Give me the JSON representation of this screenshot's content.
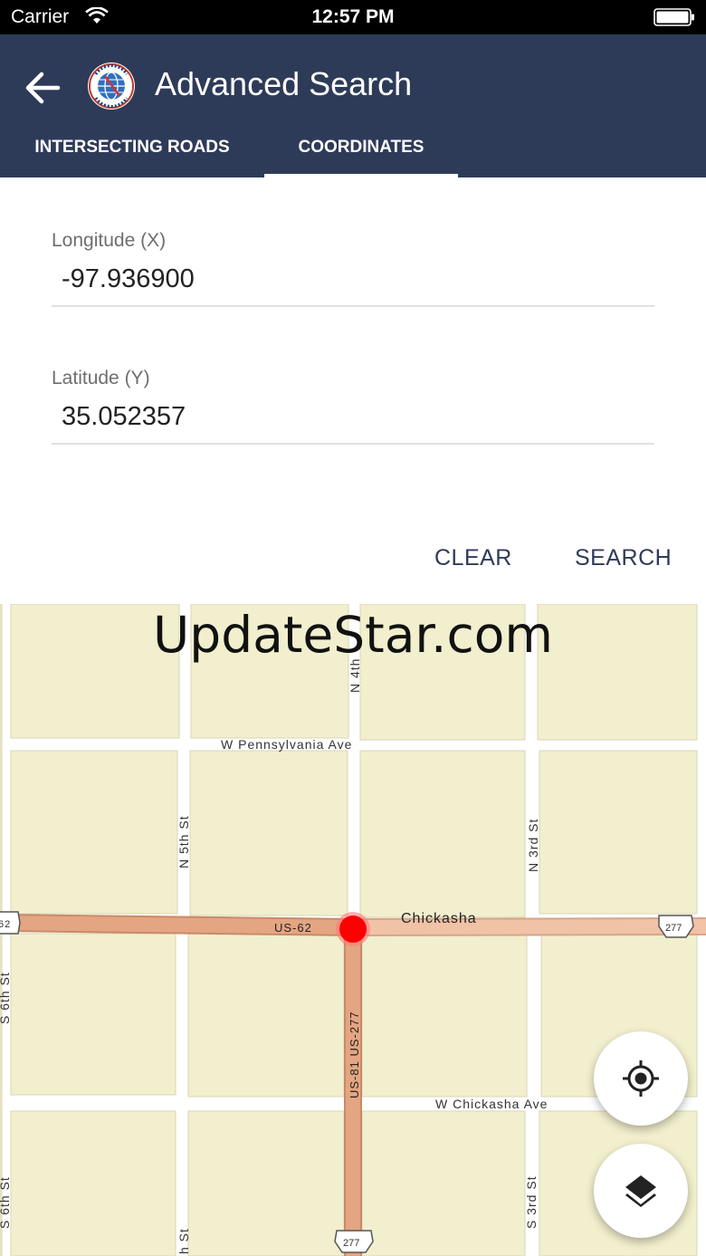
{
  "status_bar": {
    "carrier": "Carrier",
    "time": "12:57 PM"
  },
  "app_bar": {
    "title": "Advanced Search",
    "logo_text": "SPATIAL DATA RESEARCH",
    "tabs": [
      {
        "label": "INTERSECTING ROADS",
        "selected": false
      },
      {
        "label": "COORDINATES",
        "selected": true
      }
    ]
  },
  "form": {
    "longitude": {
      "label": "Longitude (X)",
      "value": "-97.936900"
    },
    "latitude": {
      "label": "Latitude (Y)",
      "value": "35.052357"
    },
    "clear_label": "CLEAR",
    "search_label": "SEARCH"
  },
  "map": {
    "watermark": "UpdateStar.com",
    "street_labels": {
      "n_4th": "N 4th",
      "pennsylvania": "W Pennsylvania Ave",
      "n_5th": "N 5th St",
      "n_3rd": "N 3rd St",
      "us62_left": "62",
      "us62": "US-62",
      "chickasha": "Chickasha",
      "us277_shield_right": "277",
      "s_6th_top": "S 6th St",
      "us81_277": "US-81 US-277",
      "w_chickasha": "W Chickasha Ave",
      "s_6th": "S 6th St",
      "s_3rd": "S 3rd St",
      "h_st": "h St",
      "us277_shield_bottom": "277"
    },
    "colors": {
      "block": "#f2efce",
      "street": "#ffffff",
      "highway": "#e0a07d",
      "marker": "#ff0000"
    }
  },
  "icons": {
    "back": "arrow-left-icon",
    "logo": "globe-logo-icon",
    "locate": "crosshair-locate-icon",
    "layers": "layers-icon"
  },
  "theme": {
    "app_bar": "#2e3b58",
    "accent_text": "#2e3b58"
  }
}
